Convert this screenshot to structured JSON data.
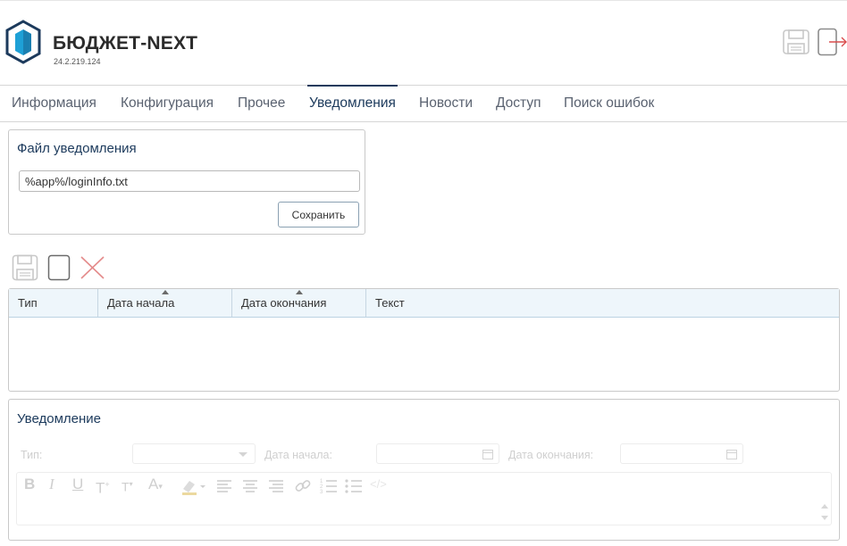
{
  "app": {
    "title": "БЮДЖЕТ-NEXT",
    "version": "24.2.219.124"
  },
  "colors": {
    "accent": "#1c3a5c",
    "logo_primary": "#1ea0d6",
    "logo_dark": "#1c3a5c",
    "delete_red": "#e48b8b",
    "grid_header_bg": "#eef6fb"
  },
  "header_icons": [
    "save-icon",
    "exit-icon"
  ],
  "tabs": [
    {
      "label": "Информация",
      "active": false
    },
    {
      "label": "Конфигурация",
      "active": false
    },
    {
      "label": "Прочее",
      "active": false
    },
    {
      "label": "Уведомления",
      "active": true
    },
    {
      "label": "Новости",
      "active": false
    },
    {
      "label": "Доступ",
      "active": false
    },
    {
      "label": "Поиск ошибок",
      "active": false
    }
  ],
  "file_panel": {
    "title": "Файл уведомления",
    "value": "%app%/loginInfo.txt",
    "save_label": "Сохранить"
  },
  "toolbar_icons": [
    "save-icon",
    "new-icon",
    "delete-icon"
  ],
  "grid": {
    "columns": [
      {
        "label": "Тип",
        "sorted": false
      },
      {
        "label": "Дата начала",
        "sorted": true
      },
      {
        "label": "Дата окончания",
        "sorted": true
      },
      {
        "label": "Текст",
        "sorted": false
      }
    ],
    "rows": []
  },
  "notification": {
    "title": "Уведомление",
    "type_label": "Тип:",
    "type_value": "",
    "start_label": "Дата начала:",
    "start_value": "",
    "end_label": "Дата окончания:",
    "end_value": "",
    "editor_tools": [
      "bold",
      "italic",
      "underline",
      "superscript",
      "subscript",
      "font-color",
      "highlight",
      "align-left",
      "align-center",
      "align-right",
      "link",
      "ordered-list",
      "unordered-list",
      "code"
    ]
  }
}
